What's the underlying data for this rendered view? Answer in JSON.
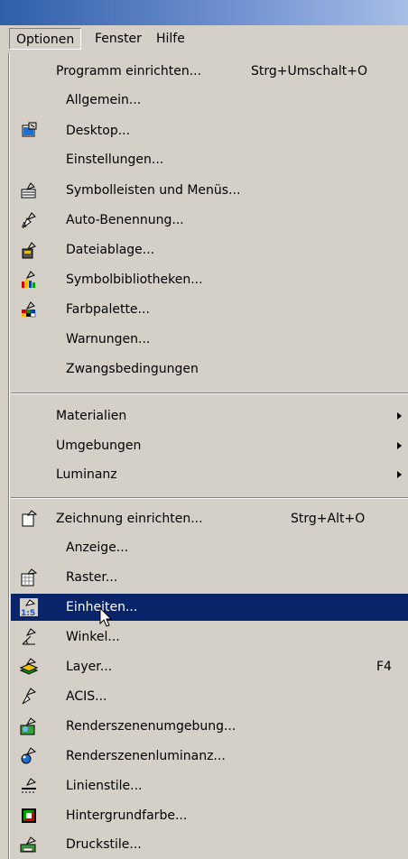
{
  "menubar": {
    "items": [
      {
        "label": "Optionen"
      },
      {
        "label": "Fenster"
      },
      {
        "label": "Hilfe"
      }
    ]
  },
  "menu": {
    "items": [
      {
        "label": "Programm einrichten...",
        "shortcut": "Strg+Umschalt+O",
        "icon": null
      },
      {
        "label": "Allgemein...",
        "icon": null
      },
      {
        "label": "Desktop...",
        "icon": "desktop-settings-icon"
      },
      {
        "label": "Einstellungen...",
        "icon": null
      },
      {
        "label": "Symbolleisten und Menüs...",
        "icon": "toolbars-icon"
      },
      {
        "label": "Auto-Benennung...",
        "icon": "auto-naming-icon"
      },
      {
        "label": "Dateiablage...",
        "icon": "file-storage-icon"
      },
      {
        "label": "Symbolbibliotheken...",
        "icon": "symbol-library-icon"
      },
      {
        "label": "Farbpalette...",
        "icon": "color-palette-icon"
      },
      {
        "label": "Warnungen...",
        "icon": null
      },
      {
        "label": "Zwangsbedingungen",
        "icon": null
      },
      {
        "label": "Materialien",
        "submenu": true
      },
      {
        "label": "Umgebungen",
        "submenu": true
      },
      {
        "label": "Luminanz",
        "submenu": true
      },
      {
        "label": "Zeichnung einrichten...",
        "shortcut": "Strg+Alt+O",
        "icon": "drawing-setup-icon"
      },
      {
        "label": "Anzeige...",
        "icon": null
      },
      {
        "label": "Raster...",
        "icon": "grid-icon"
      },
      {
        "label": "Einheiten...",
        "icon": "units-icon",
        "highlighted": true
      },
      {
        "label": "Winkel...",
        "icon": "angle-icon"
      },
      {
        "label": "Layer...",
        "shortcut": "F4",
        "icon": "layer-icon"
      },
      {
        "label": "ACIS...",
        "icon": "acis-icon"
      },
      {
        "label": "Renderszenenumgebung...",
        "icon": "render-environment-icon"
      },
      {
        "label": "Renderszenenluminanz...",
        "icon": "render-luminance-icon"
      },
      {
        "label": "Linienstile...",
        "icon": "line-styles-icon"
      },
      {
        "label": "Hintergrundfarbe...",
        "icon": "background-color-icon"
      },
      {
        "label": "Druckstile...",
        "icon": "print-styles-icon"
      }
    ]
  },
  "colors": {
    "highlight": "#0a246a",
    "menu_bg": "#d4d0c8",
    "titlebar": "#2f5fa8"
  }
}
